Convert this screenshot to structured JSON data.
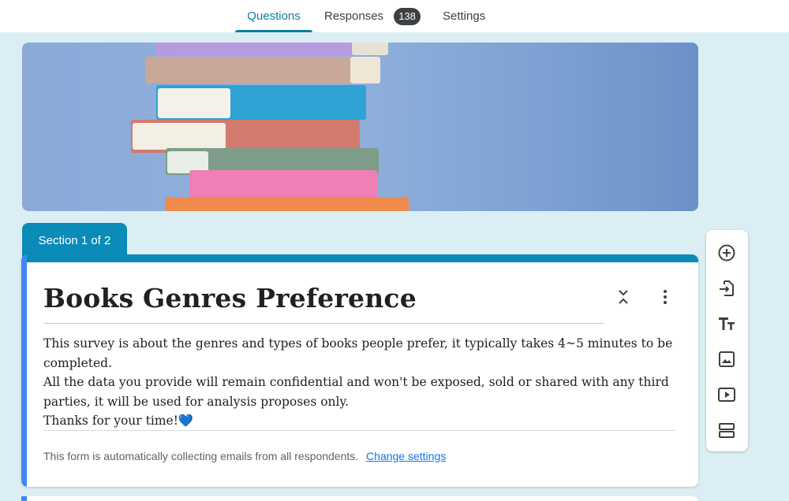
{
  "nav": {
    "tabs": [
      {
        "label": "Questions",
        "active": true
      },
      {
        "label": "Responses",
        "badge": "138"
      },
      {
        "label": "Settings"
      }
    ]
  },
  "section": {
    "label": "Section 1 of 2"
  },
  "form": {
    "title": "Books Genres Preference",
    "description_lines": [
      "This survey is about the genres and types of books people prefer, it typically takes 4~5 minutes to be",
      "completed.",
      "All the data you provide will remain confidential and won't be exposed, sold or shared with any third",
      "parties, it will be used for analysis proposes only.",
      "Thanks for your time!"
    ],
    "heart_emoji": "💙",
    "email_note": "This form is automatically collecting emails from all respondents.",
    "change_settings_link": "Change settings"
  },
  "toolbar": {
    "icons": [
      "add-question-icon",
      "import-questions-icon",
      "add-title-icon",
      "add-image-icon",
      "add-video-icon",
      "add-section-icon"
    ]
  },
  "colors": {
    "accent": "#0b8bb8",
    "tab_active": "#0b7ea0",
    "left_bar": "#4285f4",
    "background": "#dbeef4"
  }
}
